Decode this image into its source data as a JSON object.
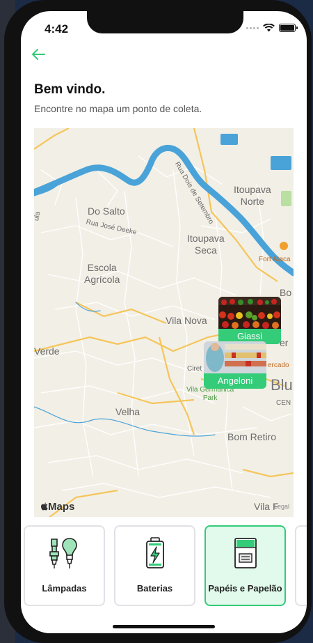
{
  "status_bar": {
    "time": "4:42"
  },
  "header": {
    "title": "Bem vindo.",
    "subtitle": "Encontre no mapa um ponto de coleta."
  },
  "map": {
    "labels": {
      "do_salto": "Do Salto",
      "rua_jose_deeke": "Rua José Deeke",
      "rua_dois_de_setembro": "Rua Dois de Setembro",
      "itoupava_norte": "Itoupava\nNorte",
      "itoupava_seca": "Itoupava\nSeca",
      "escola_agricola": "Escola\nAgrícola",
      "fort_atacadista": "Fort Ataca",
      "vila_nova": "Vila Nova",
      "verde": "Verde",
      "velha": "Velha",
      "bom_retiro": "Bom Retiro",
      "vila_germanica": "Vila Germânica\nPark",
      "mercado": "ercado",
      "blu": "Blu",
      "centro": "CEN",
      "bo": "Bo",
      "er": "er",
      "ciret": "Ciret",
      "vila_edge": "Vila F",
      "left_edge": "ula"
    },
    "attribution": "Maps",
    "legal": "Legal"
  },
  "markers": [
    {
      "name": "Giassi"
    },
    {
      "name": "Angeloni"
    }
  ],
  "categories": [
    {
      "label": "Lâmpadas",
      "icon": "lamp-icon",
      "selected": false
    },
    {
      "label": "Baterias",
      "icon": "battery-icon",
      "selected": false
    },
    {
      "label": "Papéis e Papelão",
      "icon": "paper-icon",
      "selected": true
    }
  ],
  "colors": {
    "accent": "#34cb79",
    "selected_bg": "#e1faec",
    "water": "#4aa3d8",
    "road": "#f5c55a"
  }
}
